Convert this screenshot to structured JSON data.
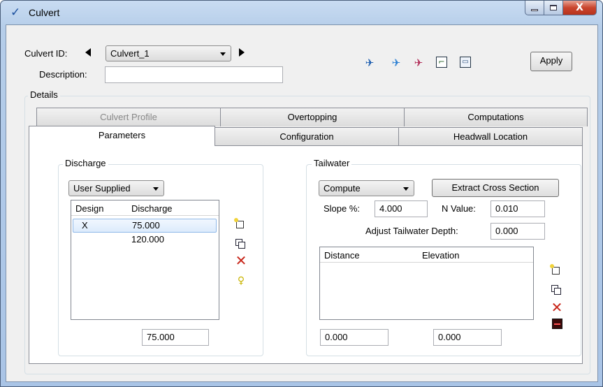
{
  "window": {
    "title": "Culvert",
    "close_glyph": "X"
  },
  "header": {
    "culvert_id_label": "Culvert ID:",
    "culvert_id_value": "Culvert_1",
    "description_label": "Description:",
    "description_value": "",
    "apply_label": "Apply",
    "toolbar_icons": [
      "add-culvert-icon",
      "edit-culvert-icon",
      "delete-culvert-icon",
      "profile-view-icon",
      "report-view-icon"
    ]
  },
  "details": {
    "label": "Details",
    "tabs_row1": [
      {
        "label": "Culvert Profile",
        "enabled": false
      },
      {
        "label": "Overtopping",
        "enabled": true
      },
      {
        "label": "Computations",
        "enabled": true
      }
    ],
    "tabs_row2": [
      {
        "label": "Parameters",
        "active": true
      },
      {
        "label": "Configuration",
        "active": false
      },
      {
        "label": "Headwall Location",
        "active": false
      }
    ]
  },
  "discharge": {
    "title": "Discharge",
    "mode": "User Supplied",
    "columns": [
      "Design",
      "Discharge"
    ],
    "rows": [
      {
        "design": "X",
        "discharge": "75.000",
        "selected": true
      },
      {
        "design": "",
        "discharge": "120.000",
        "selected": false
      }
    ],
    "value": "75.000"
  },
  "tailwater": {
    "title": "Tailwater",
    "mode": "Compute",
    "extract_label": "Extract Cross Section",
    "slope_label": "Slope %:",
    "slope_value": "4.000",
    "n_label": "N Value:",
    "n_value": "0.010",
    "adjust_label": "Adjust Tailwater Depth:",
    "adjust_value": "0.000",
    "columns": [
      "Distance",
      "Elevation"
    ],
    "distance_value": "0.000",
    "elevation_value": "0.000"
  },
  "colors": {
    "accent": "#1a4f9e",
    "close_red": "#c9452e",
    "selection": "#dcebfc"
  }
}
